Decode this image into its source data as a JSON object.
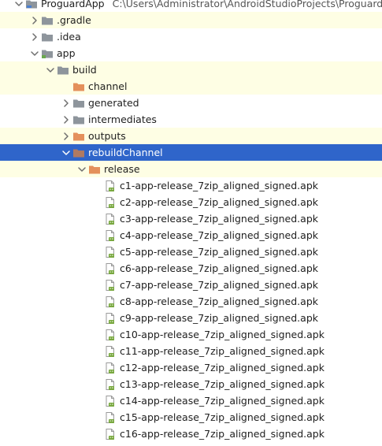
{
  "project": {
    "name": "ProguardApp",
    "path": "C:\\Users\\Administrator\\AndroidStudioProjects\\ProguardApp"
  },
  "colors": {
    "selection": "#2f65ca",
    "highlight": "#fefee4",
    "folder_gray": "#8e959c",
    "folder_orange": "#e4905b",
    "folder_selected": "#b07a62",
    "apk_badge": "#78a83e"
  },
  "tree": [
    {
      "label": "ProguardApp",
      "depth": 0,
      "arrow": "down",
      "icon": "project-folder-icon",
      "name": "tree-item-proguardapp",
      "path_text": true
    },
    {
      "label": ".gradle",
      "depth": 1,
      "arrow": "right",
      "icon": "folder-icon",
      "name": "tree-item-gradle",
      "highlight": true
    },
    {
      "label": ".idea",
      "depth": 1,
      "arrow": "right",
      "icon": "folder-icon",
      "name": "tree-item-idea"
    },
    {
      "label": "app",
      "depth": 1,
      "arrow": "down",
      "icon": "module-folder-icon",
      "name": "tree-item-app"
    },
    {
      "label": "build",
      "depth": 2,
      "arrow": "down",
      "icon": "folder-icon",
      "name": "tree-item-build",
      "highlight": true
    },
    {
      "label": "channel",
      "depth": 3,
      "arrow": "none",
      "icon": "excluded-folder-icon",
      "name": "tree-item-channel",
      "highlight": true
    },
    {
      "label": "generated",
      "depth": 3,
      "arrow": "right",
      "icon": "folder-icon",
      "name": "tree-item-generated"
    },
    {
      "label": "intermediates",
      "depth": 3,
      "arrow": "right",
      "icon": "folder-icon",
      "name": "tree-item-intermediates"
    },
    {
      "label": "outputs",
      "depth": 3,
      "arrow": "right",
      "icon": "excluded-folder-icon",
      "name": "tree-item-outputs",
      "highlight": true
    },
    {
      "label": "rebuildChannel",
      "depth": 3,
      "arrow": "down",
      "icon": "excluded-folder-icon",
      "name": "tree-item-rebuildchannel",
      "selected": true
    },
    {
      "label": "release",
      "depth": 4,
      "arrow": "down",
      "icon": "excluded-folder-icon",
      "name": "tree-item-release",
      "highlight": true
    },
    {
      "label": "c1-app-release_7zip_aligned_signed.apk",
      "depth": 5,
      "arrow": "none",
      "icon": "apk-file-icon",
      "name": "tree-item-apk-c1"
    },
    {
      "label": "c2-app-release_7zip_aligned_signed.apk",
      "depth": 5,
      "arrow": "none",
      "icon": "apk-file-icon",
      "name": "tree-item-apk-c2"
    },
    {
      "label": "c3-app-release_7zip_aligned_signed.apk",
      "depth": 5,
      "arrow": "none",
      "icon": "apk-file-icon",
      "name": "tree-item-apk-c3"
    },
    {
      "label": "c4-app-release_7zip_aligned_signed.apk",
      "depth": 5,
      "arrow": "none",
      "icon": "apk-file-icon",
      "name": "tree-item-apk-c4"
    },
    {
      "label": "c5-app-release_7zip_aligned_signed.apk",
      "depth": 5,
      "arrow": "none",
      "icon": "apk-file-icon",
      "name": "tree-item-apk-c5"
    },
    {
      "label": "c6-app-release_7zip_aligned_signed.apk",
      "depth": 5,
      "arrow": "none",
      "icon": "apk-file-icon",
      "name": "tree-item-apk-c6"
    },
    {
      "label": "c7-app-release_7zip_aligned_signed.apk",
      "depth": 5,
      "arrow": "none",
      "icon": "apk-file-icon",
      "name": "tree-item-apk-c7"
    },
    {
      "label": "c8-app-release_7zip_aligned_signed.apk",
      "depth": 5,
      "arrow": "none",
      "icon": "apk-file-icon",
      "name": "tree-item-apk-c8"
    },
    {
      "label": "c9-app-release_7zip_aligned_signed.apk",
      "depth": 5,
      "arrow": "none",
      "icon": "apk-file-icon",
      "name": "tree-item-apk-c9"
    },
    {
      "label": "c10-app-release_7zip_aligned_signed.apk",
      "depth": 5,
      "arrow": "none",
      "icon": "apk-file-icon",
      "name": "tree-item-apk-c10"
    },
    {
      "label": "c11-app-release_7zip_aligned_signed.apk",
      "depth": 5,
      "arrow": "none",
      "icon": "apk-file-icon",
      "name": "tree-item-apk-c11"
    },
    {
      "label": "c12-app-release_7zip_aligned_signed.apk",
      "depth": 5,
      "arrow": "none",
      "icon": "apk-file-icon",
      "name": "tree-item-apk-c12"
    },
    {
      "label": "c13-app-release_7zip_aligned_signed.apk",
      "depth": 5,
      "arrow": "none",
      "icon": "apk-file-icon",
      "name": "tree-item-apk-c13"
    },
    {
      "label": "c14-app-release_7zip_aligned_signed.apk",
      "depth": 5,
      "arrow": "none",
      "icon": "apk-file-icon",
      "name": "tree-item-apk-c14"
    },
    {
      "label": "c15-app-release_7zip_aligned_signed.apk",
      "depth": 5,
      "arrow": "none",
      "icon": "apk-file-icon",
      "name": "tree-item-apk-c15"
    },
    {
      "label": "c16-app-release_7zip_aligned_signed.apk",
      "depth": 5,
      "arrow": "none",
      "icon": "apk-file-icon",
      "name": "tree-item-apk-c16"
    }
  ]
}
